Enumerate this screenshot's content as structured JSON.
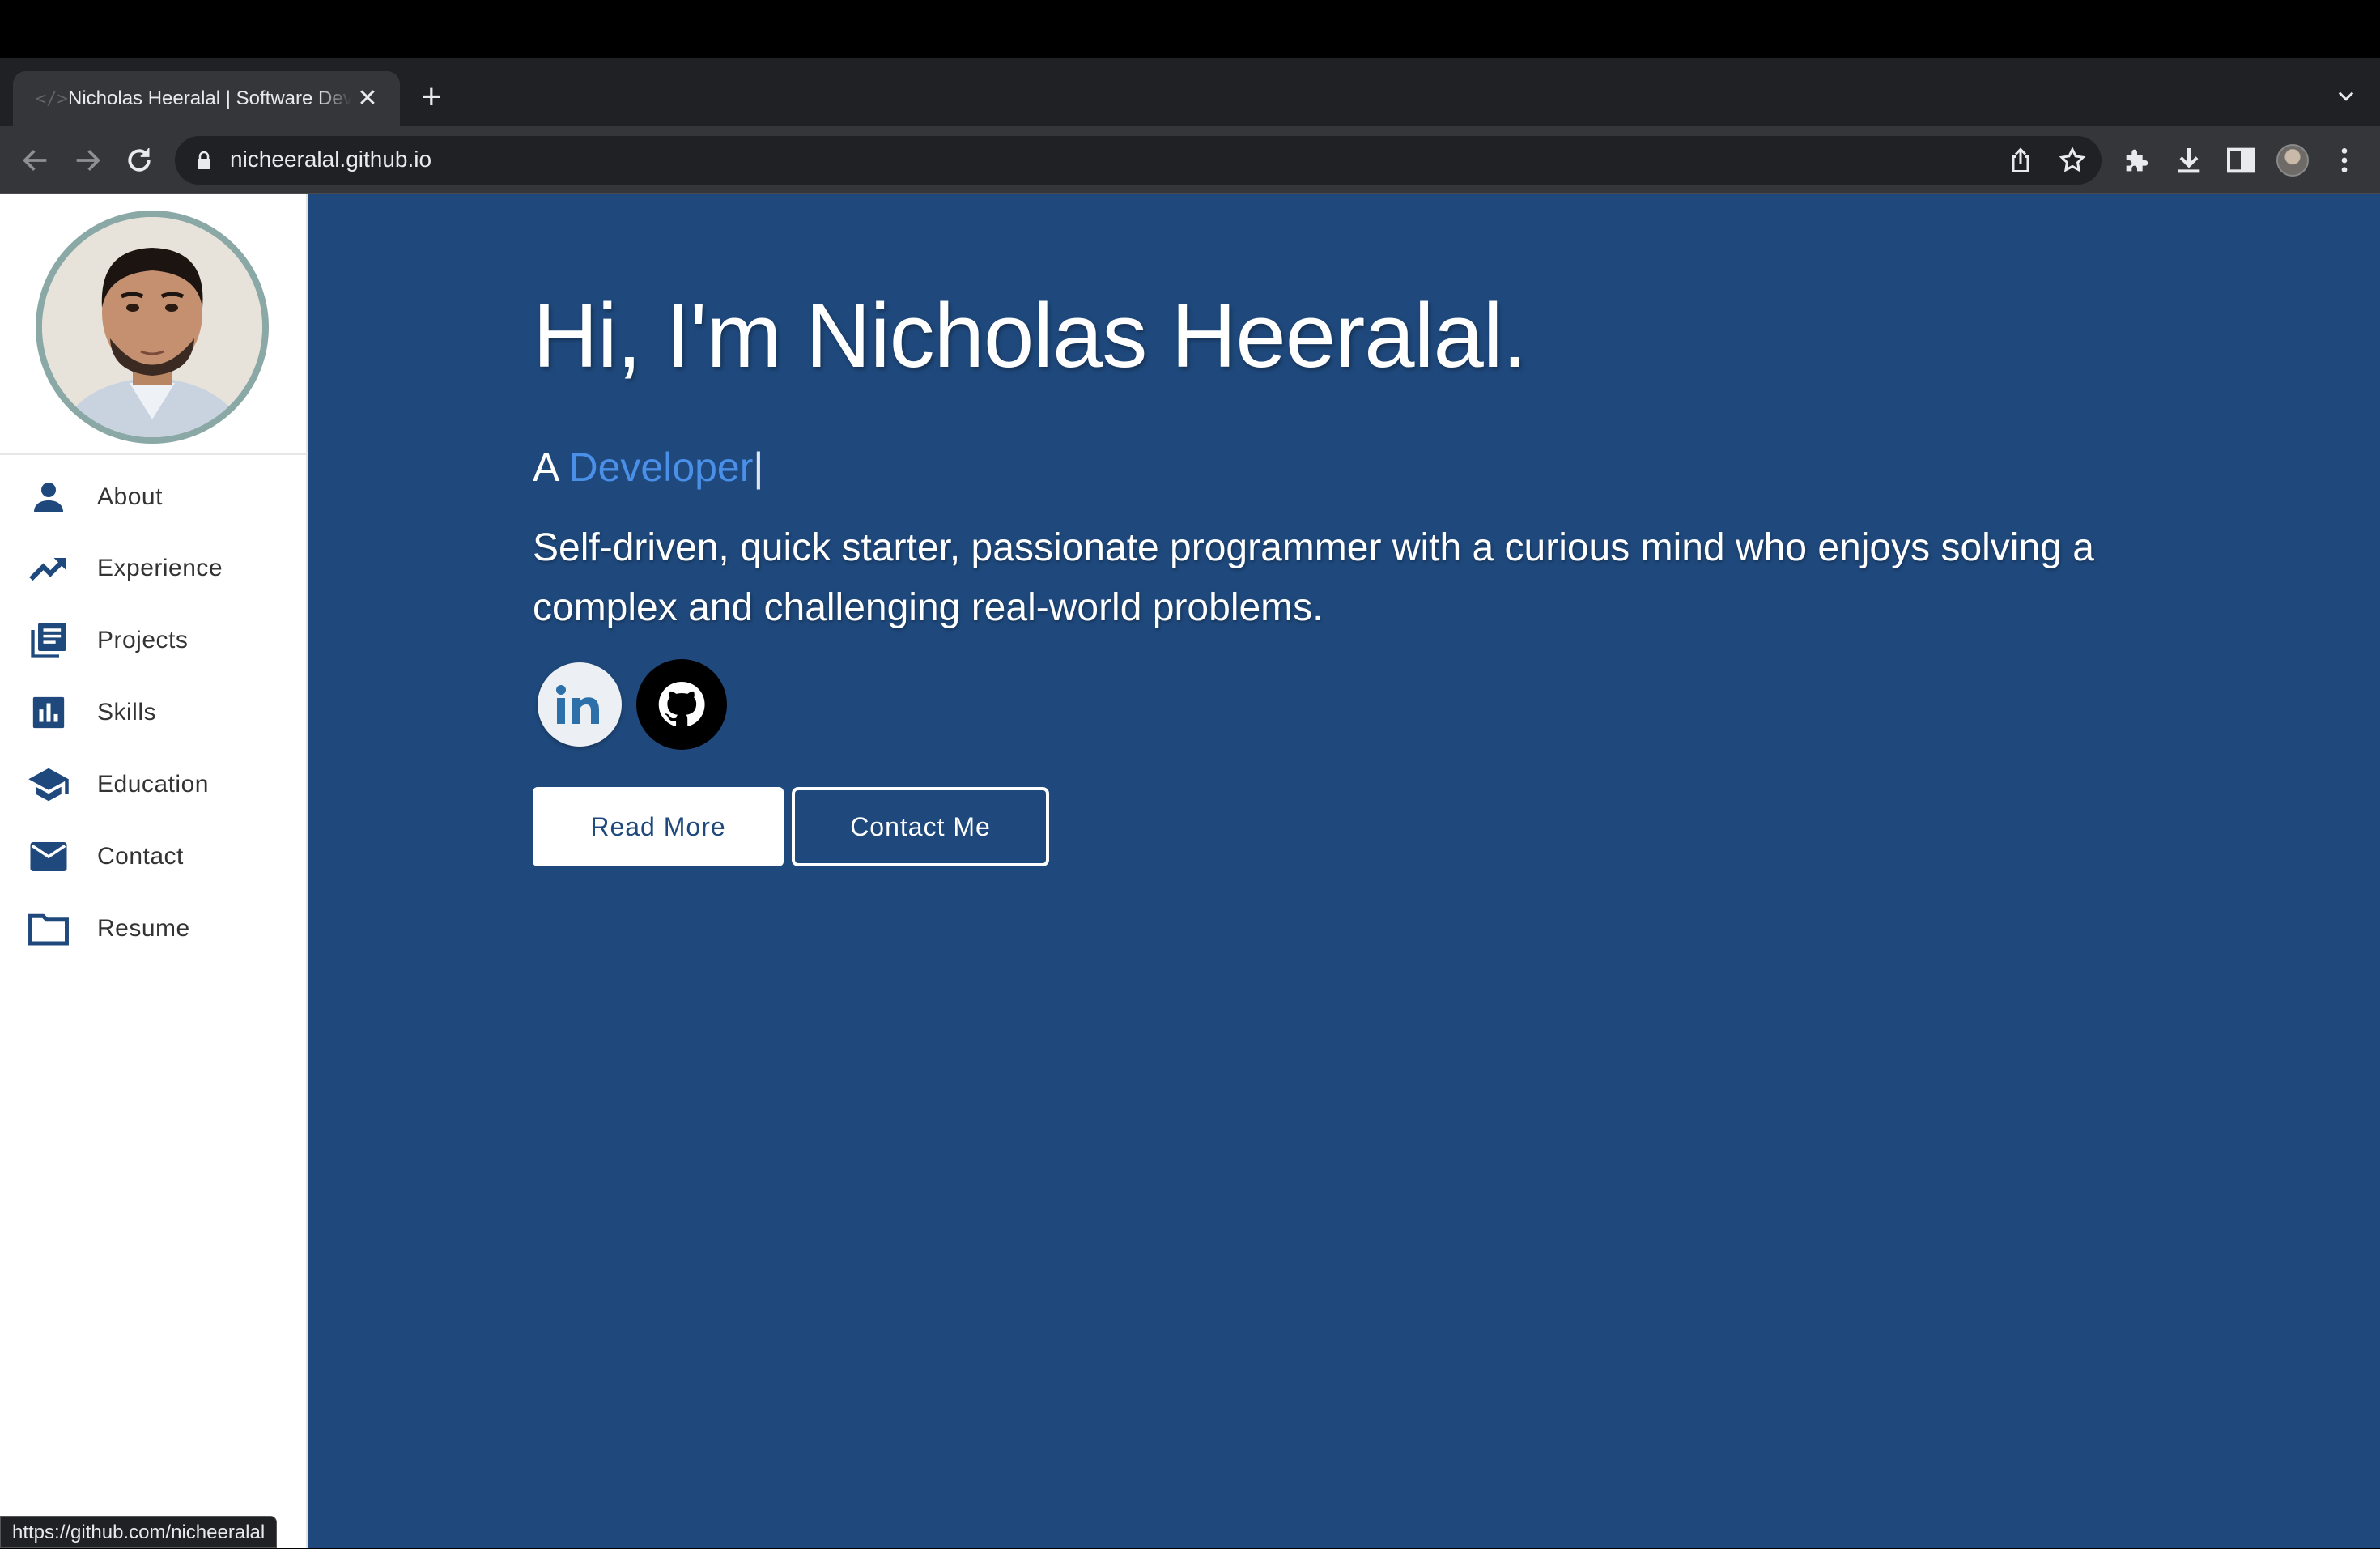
{
  "browser": {
    "tab_title": "Nicholas Heeralal | Software Developer",
    "url": "nicheeralal.github.io",
    "new_tab_label": "+",
    "close_label": "✕",
    "status_url": "https://github.com/nicheeralal"
  },
  "sidebar": {
    "items": [
      {
        "label": "About",
        "icon": "person-icon"
      },
      {
        "label": "Experience",
        "icon": "trending-up-icon"
      },
      {
        "label": "Projects",
        "icon": "library-books-icon"
      },
      {
        "label": "Skills",
        "icon": "bar-chart-icon"
      },
      {
        "label": "Education",
        "icon": "school-icon"
      },
      {
        "label": "Contact",
        "icon": "mail-icon"
      },
      {
        "label": "Resume",
        "icon": "folder-icon"
      }
    ]
  },
  "hero": {
    "title": "Hi, I'm Nicholas Heeralal.",
    "role_prefix": "A ",
    "role_word": "Developer",
    "cursor": "|",
    "description": "Self-driven, quick starter, passionate programmer with a curious mind who enjoys solving a complex and challenging real-world problems.",
    "read_more": "Read More",
    "contact_me": "Contact Me"
  },
  "colors": {
    "page_background": "#1f497d",
    "sidebar_background": "#ffffff",
    "nav_icon": "#1f497d",
    "role_accent": "#4a8fe8"
  }
}
